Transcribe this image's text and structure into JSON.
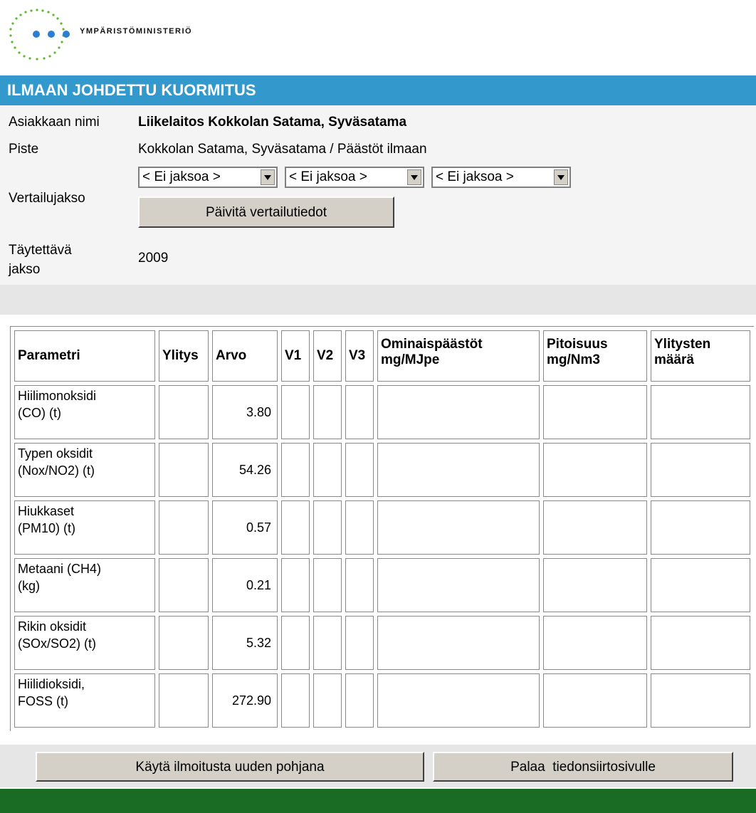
{
  "header": {
    "logo_text": "YMPÄRISTÖMINISTERIÖ"
  },
  "title": "ILMAAN JOHDETTU KUORMITUS",
  "info": {
    "client_label": "Asiakkaan nimi",
    "client_value": "Liikelaitos Kokkolan Satama, Syväsatama",
    "point_label": "Piste",
    "point_value": "Kokkolan Satama, Syväsatama / Päästöt ilmaan",
    "compare_label": "Vertailujakso",
    "selects": [
      "< Ei jaksoa >",
      "< Ei jaksoa >",
      "< Ei jaksoa >"
    ],
    "update_button": "Päivitä vertailutiedot",
    "period_label": "Täytettävä jakso",
    "period_label_line1": "Täytettävä",
    "period_label_line2": "jakso",
    "period_value": "2009"
  },
  "table": {
    "headers": [
      "Parametri",
      "Ylitys",
      "Arvo",
      "V1",
      "V2",
      "V3",
      "Ominaispäästöt mg/MJpe",
      "Pitoisuus mg/Nm3",
      "Ylitysten määrä"
    ],
    "header_lines": {
      "h6a": "Ominaispäästöt",
      "h6b": "mg/MJpe",
      "h7a": "Pitoisuus",
      "h7b": "mg/Nm3",
      "h8a": "Ylitysten",
      "h8b": "määrä"
    },
    "rows": [
      {
        "param_a": "Hiilimonoksidi",
        "param_b": "(CO) (t)",
        "arvo": "3.80"
      },
      {
        "param_a": "Typen oksidit",
        "param_b": "(Nox/NO2) (t)",
        "arvo": "54.26"
      },
      {
        "param_a": "Hiukkaset",
        "param_b": "(PM10) (t)",
        "arvo": "0.57"
      },
      {
        "param_a": "Metaani (CH4)",
        "param_b": "(kg)",
        "arvo": "0.21"
      },
      {
        "param_a": "Rikin oksidit",
        "param_b": "(SOx/SO2) (t)",
        "arvo": "5.32"
      },
      {
        "param_a": "Hiilidioksidi,",
        "param_b": "FOSS (t)",
        "arvo": "272.90"
      }
    ]
  },
  "buttons": {
    "use_as_base": "Käytä ilmoitusta uuden pohjana",
    "back": "Palaa  tiedonsiirtosivulle"
  },
  "colors": {
    "title_bar": "#3398cc",
    "footer": "#1a6b24",
    "logo_dots": "#2a7fd4",
    "logo_ring": "#5cb82e"
  },
  "icons": {
    "logo": "ministry-logo-icon",
    "dropdown": "chevron-down-icon"
  }
}
